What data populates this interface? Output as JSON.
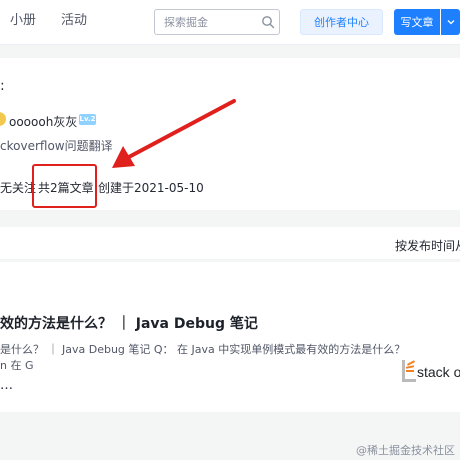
{
  "header": {
    "nav": [
      {
        "label": "小册"
      },
      {
        "label": "活动"
      }
    ],
    "search": {
      "placeholder": "探索掘金"
    },
    "creator_center_label": "创作者中心",
    "write_article_label": "写文章"
  },
  "column": {
    "colon": ":",
    "author": {
      "name": "oooooh灰灰",
      "level": "Lv.2"
    },
    "title": "ckoverflow问题翻译",
    "stats": {
      "followers": "无关注",
      "articles": "共2篇文章",
      "created": "创建于2021-05-10"
    }
  },
  "sort": {
    "label": "按发布时间从"
  },
  "article": {
    "title": "效的方法是什么？ ｜ Java Debug 笔记",
    "summary_line1": "是什么？ ｜ Java Debug 笔记 Q： 在 Java 中实现单例模式最有效的方法是什么？",
    "summary_line2": "n 在 G",
    "ellipsis": "…",
    "thumbnail_text": "stack o"
  },
  "watermark": "@稀土掘金技术社区",
  "colors": {
    "accent": "#1e80ff",
    "annotation": "#e0201c",
    "page_bg": "#f4f5f5"
  }
}
